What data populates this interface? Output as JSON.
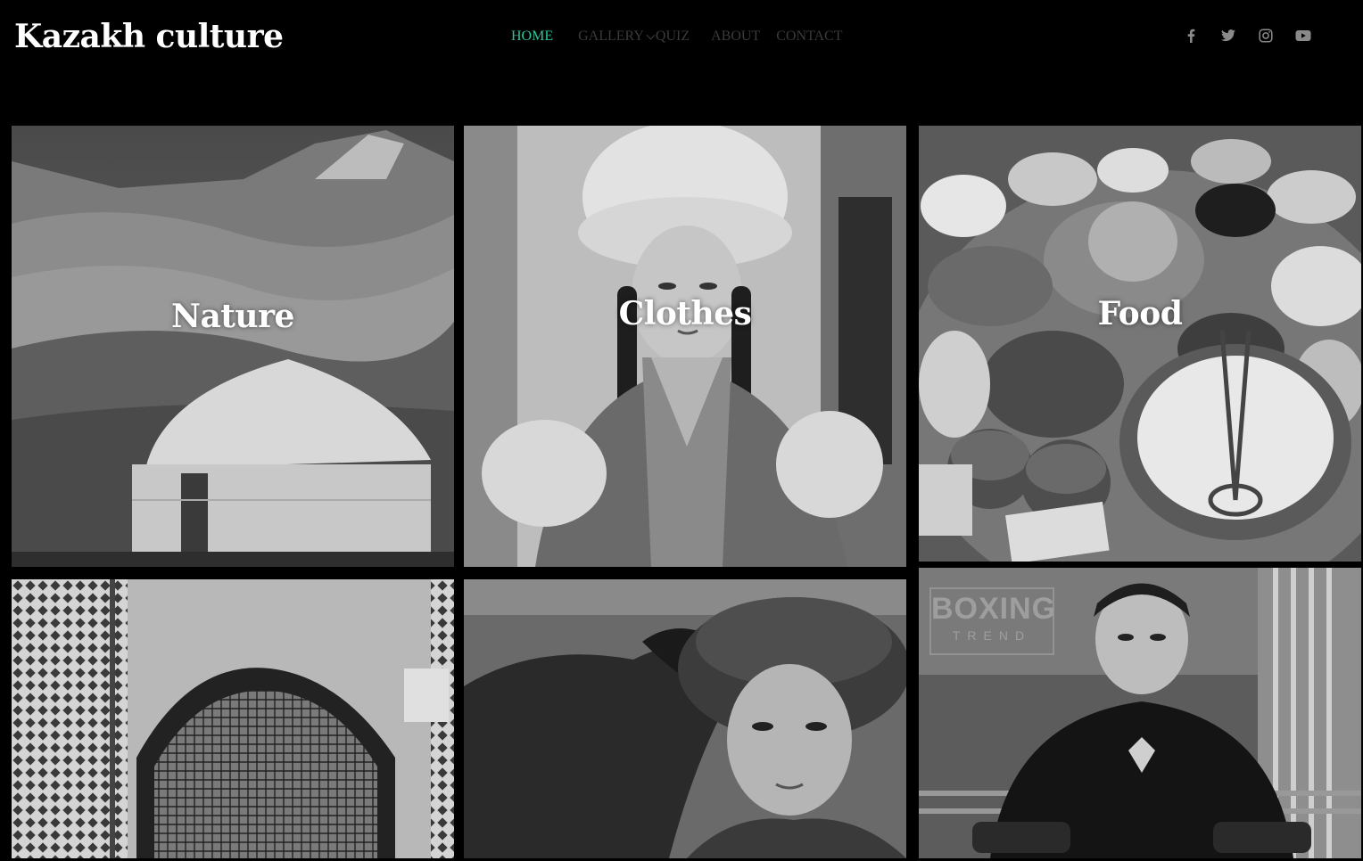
{
  "header": {
    "logo": "Kazakh culture",
    "nav": [
      {
        "label": "HOME",
        "active": true
      },
      {
        "label": "GALLERY",
        "has_dropdown": true
      },
      {
        "label": "QUIZ"
      },
      {
        "label": "ABOUT"
      },
      {
        "label": "CONTACT"
      }
    ],
    "social_icons": [
      "facebook-icon",
      "twitter-icon",
      "instagram-icon",
      "youtube-icon"
    ]
  },
  "gallery": {
    "tiles": [
      {
        "caption": "Nature",
        "image": "yurt in mountain valley"
      },
      {
        "caption": "Clothes",
        "image": "woman in traditional fur hat"
      },
      {
        "caption": "Food",
        "image": "traditional feast table"
      },
      {
        "caption": "",
        "image": "ornamental tiled arch"
      },
      {
        "caption": "",
        "image": "boy with golden eagle"
      },
      {
        "caption": "",
        "image": "boxer portrait",
        "watermark_top": "BOXING",
        "watermark_bottom": "TREND"
      }
    ]
  },
  "colors": {
    "background": "#000000",
    "nav_active": "#2fc39a",
    "nav_inactive": "#3a3a3a",
    "social_icon": "#8a8a8a"
  }
}
